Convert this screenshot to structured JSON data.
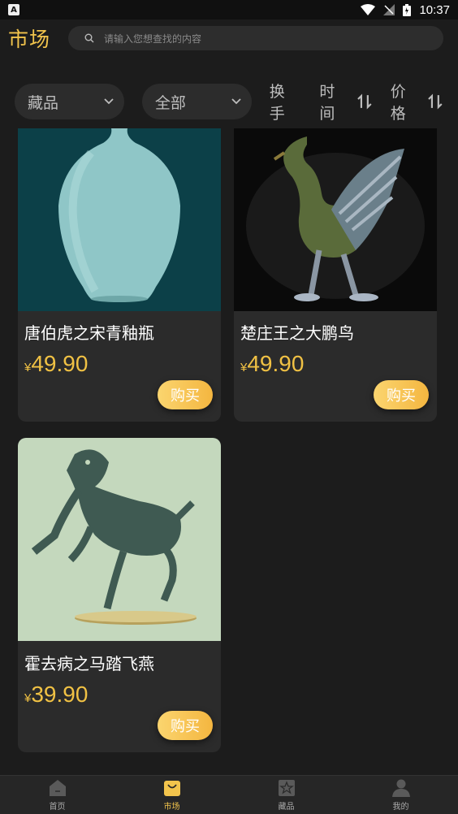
{
  "status_bar": {
    "left_badge": "A",
    "time": "10:37"
  },
  "header": {
    "title": "市场",
    "search_placeholder": "请输入您想查找的内容"
  },
  "filters": {
    "category": "藏品",
    "scope": "全部",
    "sort_trade": "换手",
    "sort_time": "时间",
    "sort_price": "价格"
  },
  "products": [
    {
      "name": "唐伯虎之宋青釉瓶",
      "currency": "¥",
      "price": "49.90",
      "buy": "购买",
      "image": "celadon-vase-image"
    },
    {
      "name": "楚庄王之大鹏鸟",
      "currency": "¥",
      "price": "49.90",
      "buy": "购买",
      "image": "bronze-crane-image"
    },
    {
      "name": "霍去病之马踏飞燕",
      "currency": "¥",
      "price": "39.90",
      "buy": "购买",
      "image": "galloping-horse-image"
    }
  ],
  "tabs": [
    {
      "label": "首页",
      "icon": "home-icon"
    },
    {
      "label": "市场",
      "icon": "market-bag-icon",
      "active": true
    },
    {
      "label": "藏品",
      "icon": "collection-icon"
    },
    {
      "label": "我的",
      "icon": "user-icon"
    }
  ],
  "colors": {
    "accent": "#f2c44c",
    "background": "#1c1c1c",
    "card": "#2b2b2b"
  }
}
